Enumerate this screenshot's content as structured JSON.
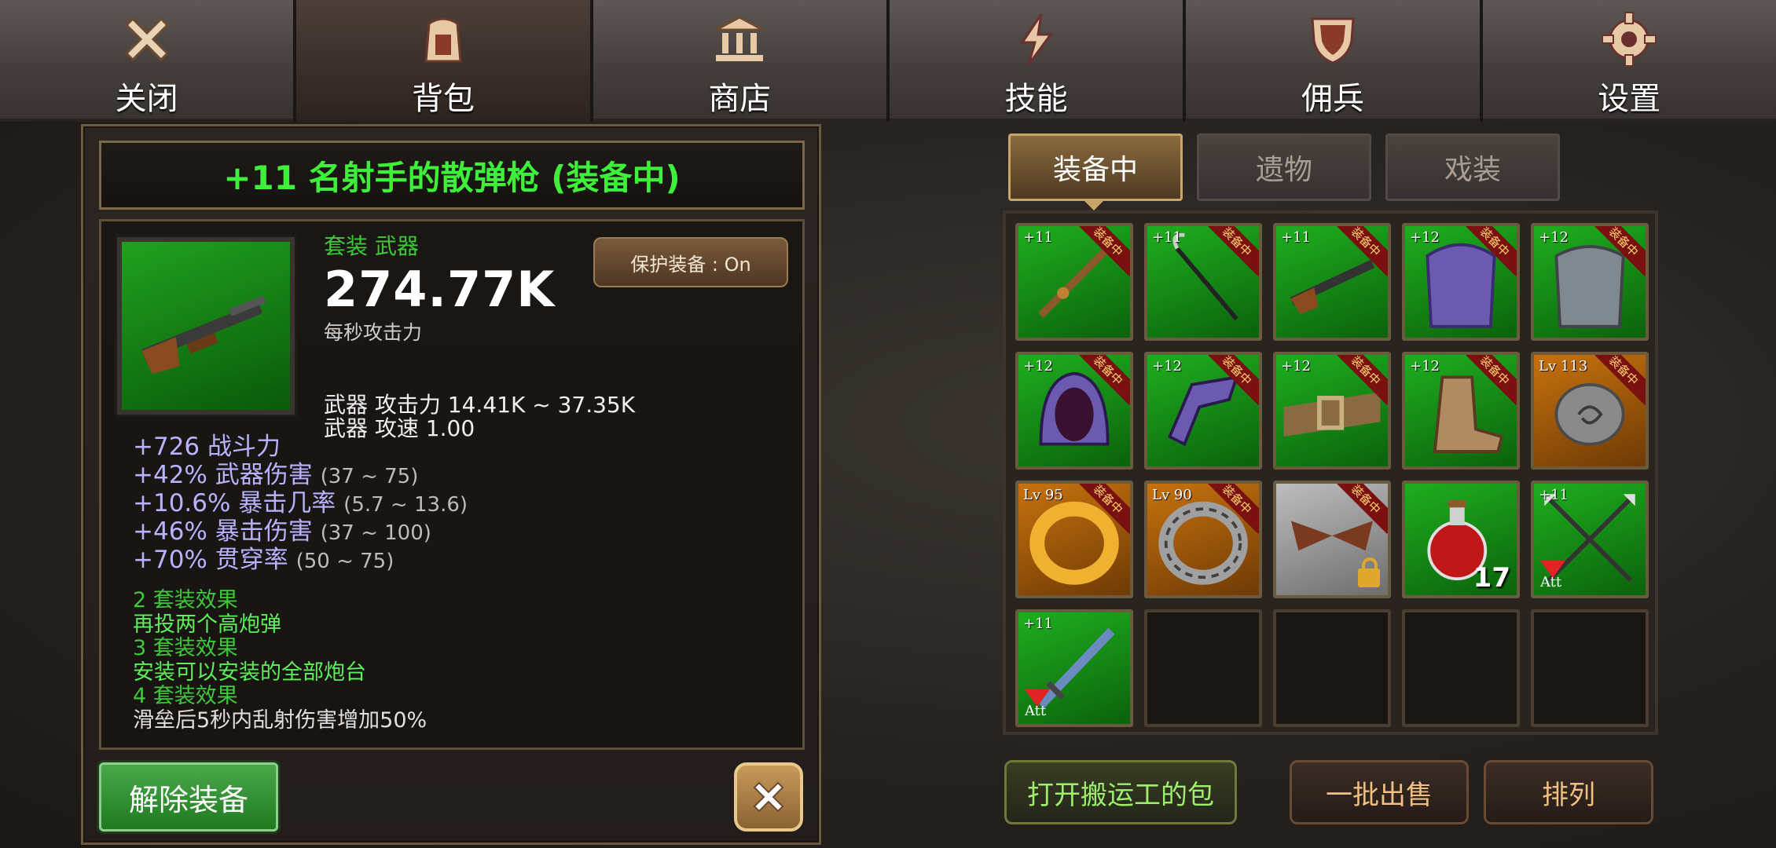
{
  "nav": {
    "tabs": [
      {
        "label": "关闭",
        "icon": "close-icon"
      },
      {
        "label": "背包",
        "icon": "backpack-icon"
      },
      {
        "label": "商店",
        "icon": "shop-icon"
      },
      {
        "label": "技能",
        "icon": "lightning-icon"
      },
      {
        "label": "佣兵",
        "icon": "shield-icon"
      },
      {
        "label": "设置",
        "icon": "gear-icon"
      }
    ],
    "active": 1
  },
  "item": {
    "title": "+11 名射手的散弹枪 (装备中)",
    "type": "套装 武器",
    "dps": "274.77K",
    "dps_label": "每秒攻击力",
    "protect_label": "保护装备 : On",
    "attack_line": "武器 攻击力 14.41K ~ 37.35K",
    "speed_line": "武器 攻速 1.00",
    "stats": [
      {
        "value": "+726 战斗力",
        "range": ""
      },
      {
        "value": "+42% 武器伤害",
        "range": "(37 ~ 75)"
      },
      {
        "value": "+10.6% 暴击几率",
        "range": "(5.7 ~ 13.6)"
      },
      {
        "value": "+46% 暴击伤害",
        "range": "(37 ~ 100)"
      },
      {
        "value": "+70% 贯穿率",
        "range": "(50 ~ 75)"
      }
    ],
    "set_effects": [
      {
        "header": "2 套装效果",
        "text": "再投两个高炮弹"
      },
      {
        "header": "3 套装效果",
        "text": "安装可以安装的全部炮台"
      },
      {
        "header": "4 套装效果",
        "text": "滑垒后5秒内乱射伤害增加50%"
      }
    ]
  },
  "buttons": {
    "unequip": "解除装备",
    "open_porter_bag": "打开搬运工的包",
    "bulk_sell": "一批出售",
    "sort": "排列"
  },
  "inventory_tabs": [
    "装备中",
    "遗物",
    "戏装"
  ],
  "equipped_badge": "装备中",
  "att_label": "Att",
  "slots": [
    {
      "level": "+11",
      "equipped": true,
      "bg": "green",
      "icon": "spear-icon"
    },
    {
      "level": "+11",
      "equipped": true,
      "bg": "green",
      "icon": "hook-staff-icon"
    },
    {
      "level": "+11",
      "equipped": true,
      "bg": "green",
      "icon": "shotgun-icon"
    },
    {
      "level": "+12",
      "equipped": true,
      "bg": "green",
      "icon": "purple-armor-icon"
    },
    {
      "level": "+12",
      "equipped": true,
      "bg": "green",
      "icon": "steel-armor-icon"
    },
    {
      "level": "+12",
      "equipped": true,
      "bg": "green",
      "icon": "hood-icon"
    },
    {
      "level": "+12",
      "equipped": true,
      "bg": "green",
      "icon": "gauntlet-icon"
    },
    {
      "level": "+12",
      "equipped": true,
      "bg": "green",
      "icon": "belt-icon"
    },
    {
      "level": "+12",
      "equipped": true,
      "bg": "green",
      "icon": "boot-icon"
    },
    {
      "level": "Lv 113",
      "equipped": true,
      "bg": "orange",
      "icon": "stone-amulet-icon"
    },
    {
      "level": "Lv 95",
      "equipped": true,
      "bg": "orange",
      "icon": "gold-ring-icon"
    },
    {
      "level": "Lv 90",
      "equipped": true,
      "bg": "orange",
      "icon": "silver-ring-icon"
    },
    {
      "level": "",
      "equipped": true,
      "bg": "gray",
      "icon": "wings-icon",
      "locked": true
    },
    {
      "level": "",
      "equipped": false,
      "bg": "green",
      "icon": "potion-icon",
      "count": "17"
    },
    {
      "level": "+11",
      "equipped": false,
      "bg": "green",
      "icon": "crossed-spears-icon",
      "att": true
    },
    {
      "level": "+11",
      "equipped": false,
      "bg": "green",
      "icon": "sword-icon",
      "att": true
    },
    {
      "empty": true
    },
    {
      "empty": true
    },
    {
      "empty": true
    },
    {
      "empty": true
    }
  ],
  "colors": {
    "title_green": "#3ef03a",
    "stat_blue": "#b9b2ff",
    "set_green": "#3ec93a",
    "item_bg_green": "#1fae1f",
    "item_bg_orange": "#c7720e"
  }
}
